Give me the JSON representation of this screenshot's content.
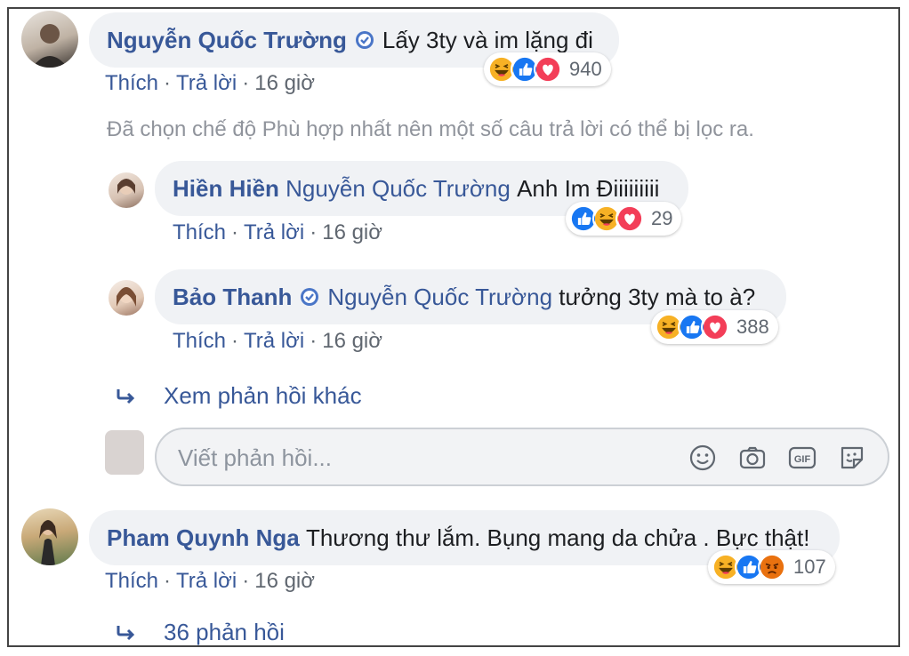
{
  "comments": [
    {
      "name": "Nguyễn Quốc Trường",
      "text": "Lấy 3ty và im lặng đi",
      "reaction_count": "940",
      "like": "Thích",
      "reply": "Trả lời",
      "time": "16 giờ"
    },
    {
      "name": "Hiền Hiền",
      "tag": "Nguyễn Quốc Trường",
      "text": "Anh Im Điiiiiiiii",
      "reaction_count": "29",
      "like": "Thích",
      "reply": "Trả lời",
      "time": "16 giờ"
    },
    {
      "name": "Bảo Thanh",
      "tag": "Nguyễn Quốc Trường",
      "text": "tưởng 3ty mà to à?",
      "reaction_count": "388",
      "like": "Thích",
      "reply": "Trả lời",
      "time": "16 giờ"
    },
    {
      "name": "Pham Quynh Nga",
      "text": "Thương thư lắm. Bụng mang da chửa . Bực thật!",
      "reaction_count": "107",
      "like": "Thích",
      "reply": "Trả lời",
      "time": "16 giờ"
    }
  ],
  "filter_note": "Đã chọn chế độ Phù hợp nhất nên một số câu trả lời có thể bị lọc ra.",
  "more_replies": "Xem phản hồi khác",
  "reply_box": {
    "placeholder": "Viết phản hồi..."
  },
  "replies_count_link": "36 phản hồi",
  "colors": {
    "link": "#385898",
    "bubble": "#f0f2f5",
    "like": "#1877f2",
    "love": "#f33e58",
    "haha": "#f7b125",
    "angry": "#e9710f"
  },
  "icons": [
    "verified-badge-icon",
    "haha-reaction-icon",
    "like-reaction-icon",
    "love-reaction-icon",
    "angry-reaction-icon",
    "reply-arrow-icon",
    "emoji-icon",
    "camera-icon",
    "gif-icon",
    "sticker-icon"
  ]
}
